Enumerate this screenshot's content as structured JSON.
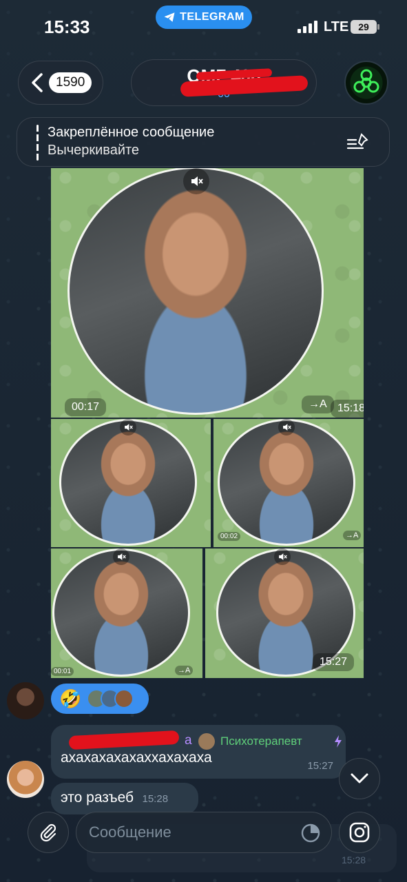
{
  "status_bar": {
    "time": "15:33",
    "app_pill": "TELEGRAM",
    "network": "LTE",
    "battery": "29"
  },
  "header": {
    "back_count": "1590",
    "chat_title": "ОМГ 406",
    "chat_subtitle": "00"
  },
  "pinned": {
    "title": "Закреплённое сообщение",
    "text": "Вычеркивайте"
  },
  "media": {
    "video_1_duration": "00:17",
    "video_1_time": "15:18",
    "video_2_duration": "00:02",
    "video_3_duration": "00:01",
    "album_time": "15:27",
    "transcribe_label": "→A"
  },
  "reactions": {
    "emoji": "🤣"
  },
  "messages": [
    {
      "role": "Психотерапевт",
      "sender_suffix": "a",
      "text": "ахахахахахаххахахаха",
      "time": "15:27"
    },
    {
      "text": "это разъеб",
      "time": "15:28"
    }
  ],
  "composer": {
    "placeholder": "Сообщение"
  },
  "underlay": {
    "time": "15:28"
  },
  "colors": {
    "accent": "#3a8ff0",
    "background": "#1c2733",
    "bubble": "#2b3a48",
    "role_green": "#5fcf7a",
    "video_bg": "#8fb877"
  }
}
